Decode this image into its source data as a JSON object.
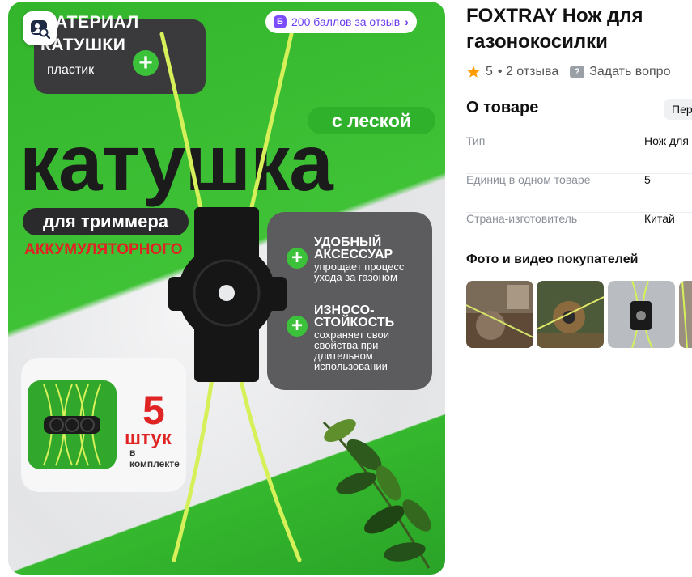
{
  "banner": {
    "bonus_label": "200 баллов за отзыв",
    "bonus_letter": "Б",
    "material_line1": "МАТЕРИАЛ",
    "material_line2": "КАТУШКИ",
    "material_line3": "пластик",
    "with_line": "с леской",
    "big_title": "катушка",
    "for_trimmer": "для триммера",
    "accumulator": "АККУМУЛЯТОРНОГО",
    "feature1_h1": "УДОБНЫЙ",
    "feature1_h2": "АКСЕССУАР",
    "feature1_t1": "упрощает процесс",
    "feature1_t2": "ухода за газоном",
    "feature2_h1": "ИЗНОСО-",
    "feature2_h2": "СТОЙКОСТЬ",
    "feature2_t1": "сохраняет свои",
    "feature2_t2": "свойства при",
    "feature2_t3": "длительном",
    "feature2_t4": "использовании",
    "kit_number": "5",
    "kit_word": "штук",
    "kit_small": "в комплекте",
    "plus": "+",
    "colors": {
      "green": "#2fb12c",
      "red": "#e02424",
      "dark": "#2a2a2c",
      "line": "#d6f05a"
    }
  },
  "product": {
    "title_line1": "FOXTRAY Нож для",
    "title_line2": "газонокосилки",
    "rating": "5",
    "reviews": "• 2 отзыва",
    "ask": "Задать вопро",
    "ask_icon": "?",
    "about_title": "О товаре",
    "about_link": "Пер",
    "specs": [
      {
        "label": "Тип",
        "value": "Нож для"
      },
      {
        "label": "Единиц в одном товаре",
        "value": "5"
      },
      {
        "label": "Страна-изготовитель",
        "value": "Китай"
      }
    ],
    "photos_title": "Фото и видео покупателей"
  }
}
